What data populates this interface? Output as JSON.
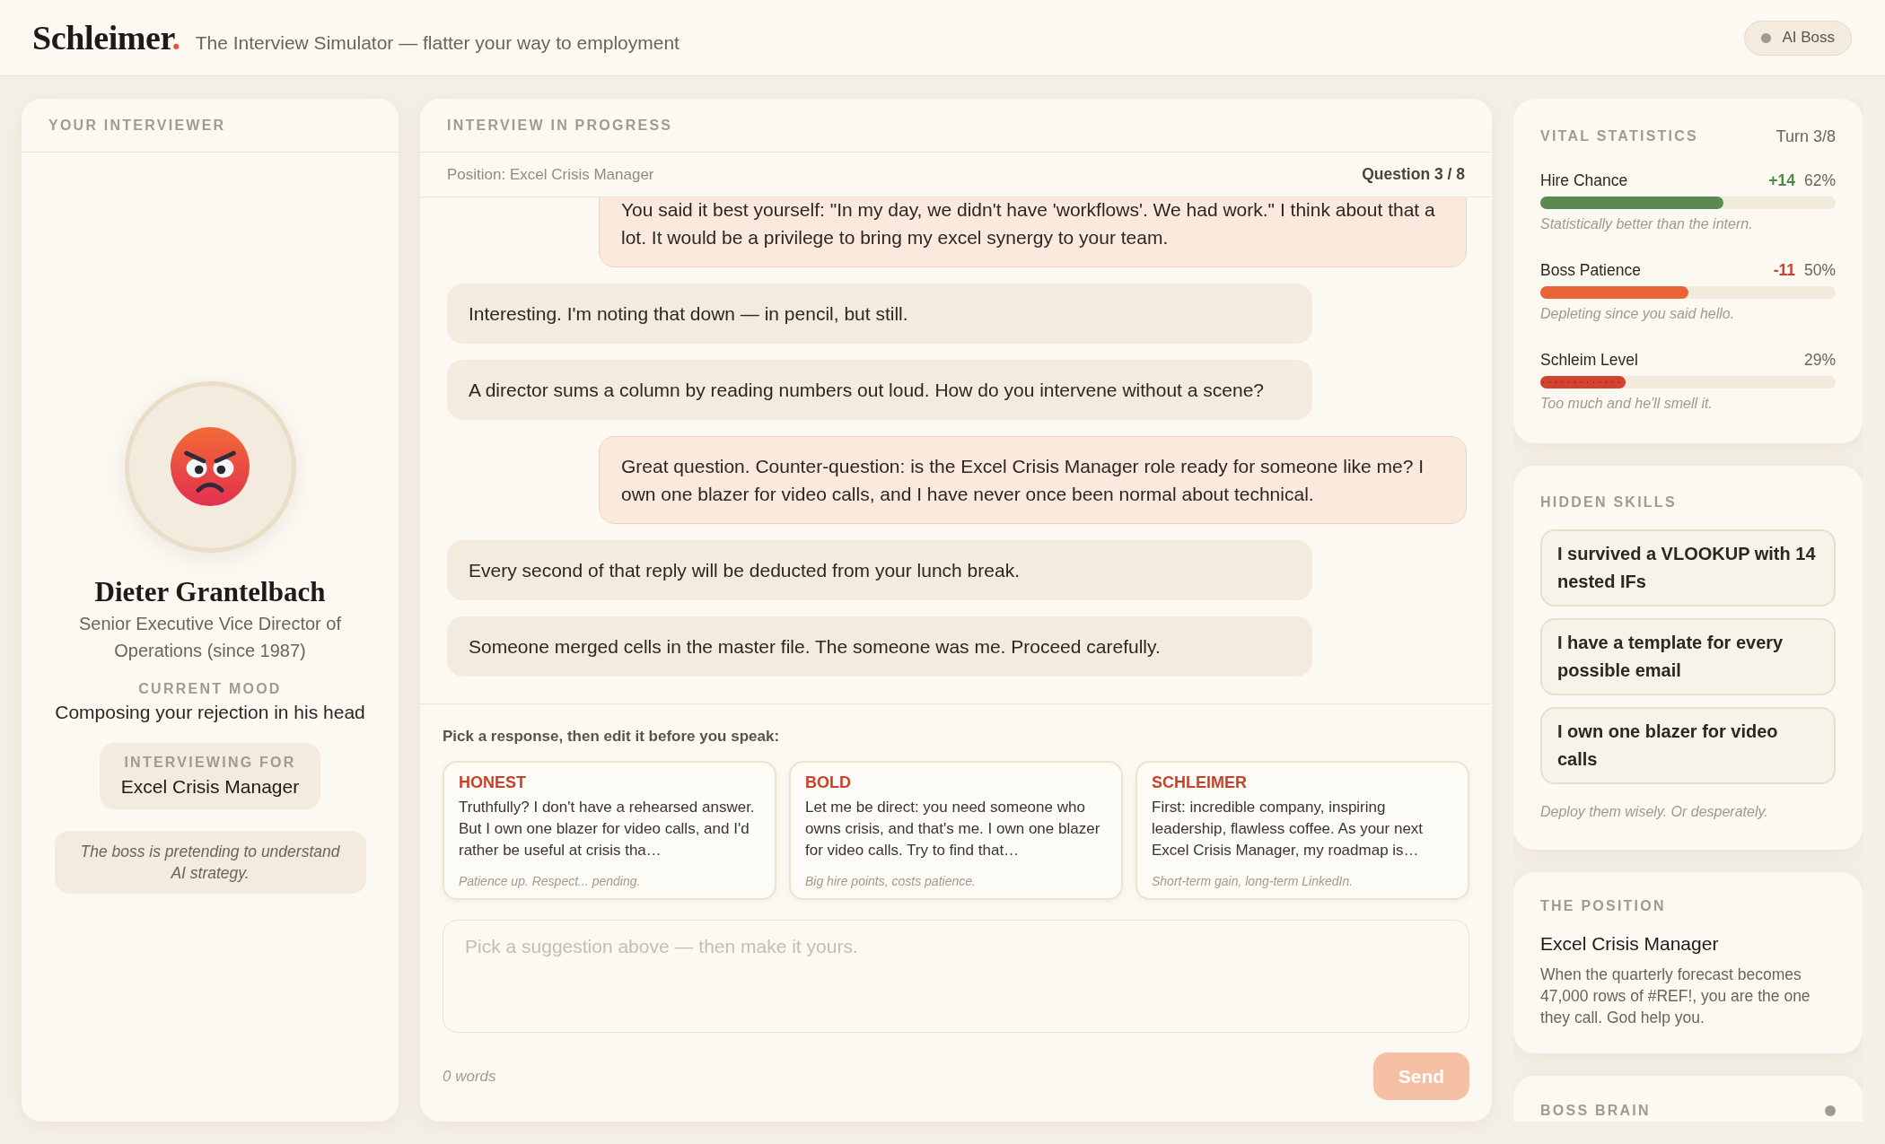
{
  "header": {
    "logo": {
      "name": "Schleimer",
      "mark": "."
    },
    "tagline": "The Interview Simulator — flatter your way to employment",
    "status_pill": {
      "label": "AI Boss"
    }
  },
  "interviewer_panel": {
    "title": "YOUR INTERVIEWER",
    "name": "Dieter Grantelbach",
    "role": "Senior Executive Vice Director of Operations (since 1987)",
    "mood_label": "CURRENT MOOD",
    "mood": "Composing your rejection in his head",
    "interviewing_for": {
      "label": "INTERVIEWING FOR",
      "value": "Excel Crisis Manager"
    },
    "note": "The boss is pretending to understand AI strategy."
  },
  "interview": {
    "title": "INTERVIEW IN PROGRESS",
    "position": "Position: Excel Crisis Manager",
    "question": "Question 3 / 8",
    "messages": [
      {
        "kind": "candidate",
        "text": "You said it best yourself: \"In my day, we didn't have 'workflows'. We had work.\" I think about that a lot. It would be a privilege to bring my excel synergy to your team."
      },
      {
        "kind": "boss",
        "text": "Interesting. I'm noting that down — in pencil, but still."
      },
      {
        "kind": "boss",
        "text": "A director sums a column by reading numbers out loud. How do you intervene without a scene?"
      },
      {
        "kind": "candidate",
        "text": "Great question. Counter-question: is the Excel Crisis Manager role ready for someone like me? I own one blazer for video calls, and I have never once been normal about technical."
      },
      {
        "kind": "boss",
        "text": "Every second of that reply will be deducted from your lunch break."
      },
      {
        "kind": "boss",
        "text": "Someone merged cells in the master file. The someone was me. Proceed carefully."
      }
    ],
    "composer": {
      "prompt": "Pick a response, then edit it before you speak:",
      "suggestions": [
        {
          "label": "HONEST",
          "text": "Truthfully? I don't have a rehearsed answer. But I own one blazer for video calls, and I'd rather be useful at crisis tha…",
          "hint": "Patience up. Respect... pending."
        },
        {
          "label": "BOLD",
          "text": "Let me be direct: you need someone who owns crisis, and that's me. I own one blazer for video calls. Try to find that…",
          "hint": "Big hire points, costs patience."
        },
        {
          "label": "SCHLEIMER",
          "text": "First: incredible company, inspiring leadership, flawless coffee. As your next Excel Crisis Manager, my roadmap is…",
          "hint": "Short-term gain, long-term LinkedIn."
        }
      ],
      "reply_field": {
        "placeholder": "Pick a suggestion above — then make it yours."
      },
      "word_count": "0 words",
      "send_button": {
        "label": "Send",
        "disabled": true
      }
    }
  },
  "sidebar": {
    "vital_statistics": {
      "title": "VITAL STATISTICS",
      "turn": "Turn 3/8",
      "stats": [
        {
          "name": "Hire Chance",
          "delta": {
            "text": "+14",
            "color": "#4f8a4a"
          },
          "reading": "62%",
          "level": 0.62,
          "color": "#5a8a52",
          "kind": "plain",
          "caption": "Statistically better than the intern."
        },
        {
          "name": "Boss Patience",
          "delta": {
            "text": "-11",
            "color": "#d0402f"
          },
          "reading": "50%",
          "level": 0.5,
          "color": "#e86337",
          "kind": "plain",
          "caption": "Depleting since you said hello."
        },
        {
          "name": "Schleim Level",
          "reading": "29%",
          "level": 0.29,
          "color": "#d2432e",
          "kind": "dotted",
          "caption": "Too much and he'll smell it."
        }
      ]
    },
    "hidden_skills": {
      "title": "HIDDEN SKILLS",
      "skills": [
        "I survived a VLOOKUP with 14 nested IFs",
        "I have a template for every possible email",
        "I own one blazer for video calls"
      ],
      "caption": "Deploy them wisely. Or desperately."
    },
    "position_card": {
      "title": "THE POSITION",
      "role": "Excel Crisis Manager",
      "description": "When the quarterly forecast becomes 47,000 rows of #REF!, you are the one they call. God help you."
    },
    "boss_brain": {
      "title": "BOSS BRAIN"
    }
  }
}
